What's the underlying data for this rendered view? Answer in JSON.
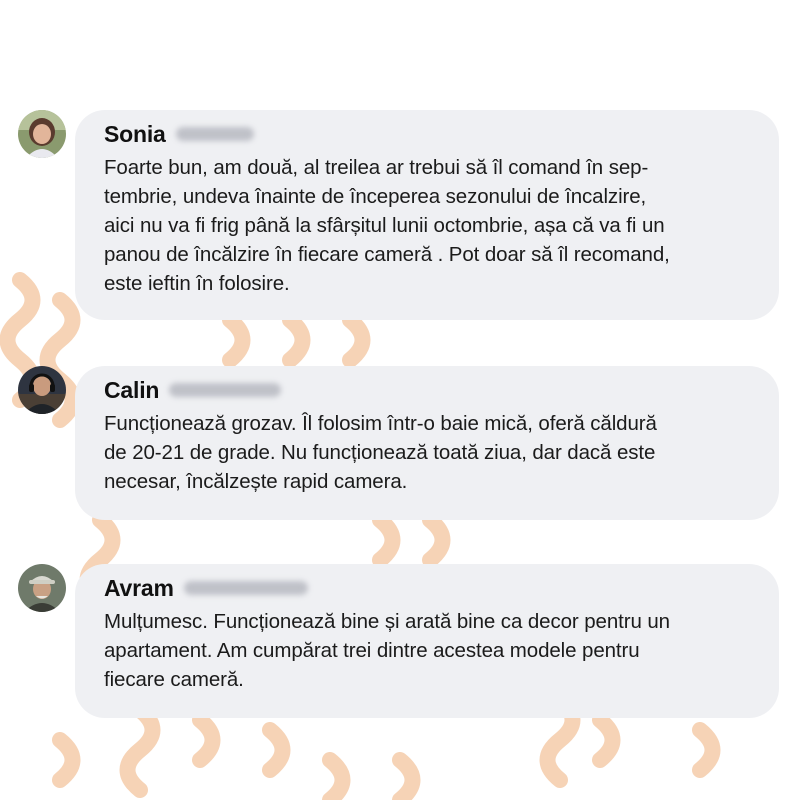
{
  "colors": {
    "bubble": "#eff0f3",
    "text": "#1b1b1b",
    "decoration": "#f6d3b6",
    "background": "#ffffff"
  },
  "comments": [
    {
      "name": "Sonia",
      "surname_blurred": true,
      "avatar": "avatar-photo-woman",
      "lines": [
        "Foarte bun, am două, al treilea ar trebui să îl comand  în sep-",
        "tembrie, undeva înainte de începerea sezonului de încalzire,",
        "aici nu va fi frig până la sfârșitul lunii octombrie, așa că va fi un",
        "panou de încălzire în fiecare cameră . Pot doar să îl recomand,",
        "este ieftin în folosire."
      ]
    },
    {
      "name": "Calin",
      "surname_blurred": true,
      "avatar": "avatar-photo-man-headphones",
      "lines": [
        "Funcționează grozav. Îl folosim într-o baie mică, oferă căldură",
        "de 20-21 de grade. Nu funcționează toată ziua, dar dacă este",
        "necesar, încălzește rapid camera."
      ]
    },
    {
      "name": "Avram",
      "surname_blurred": true,
      "avatar": "avatar-photo-man-cap",
      "lines": [
        "Mulțumesc. Funcționează bine și arată bine ca decor pentru un",
        "apartament. Am cumpărat trei dintre acestea modele pentru",
        "fiecare cameră."
      ]
    }
  ]
}
